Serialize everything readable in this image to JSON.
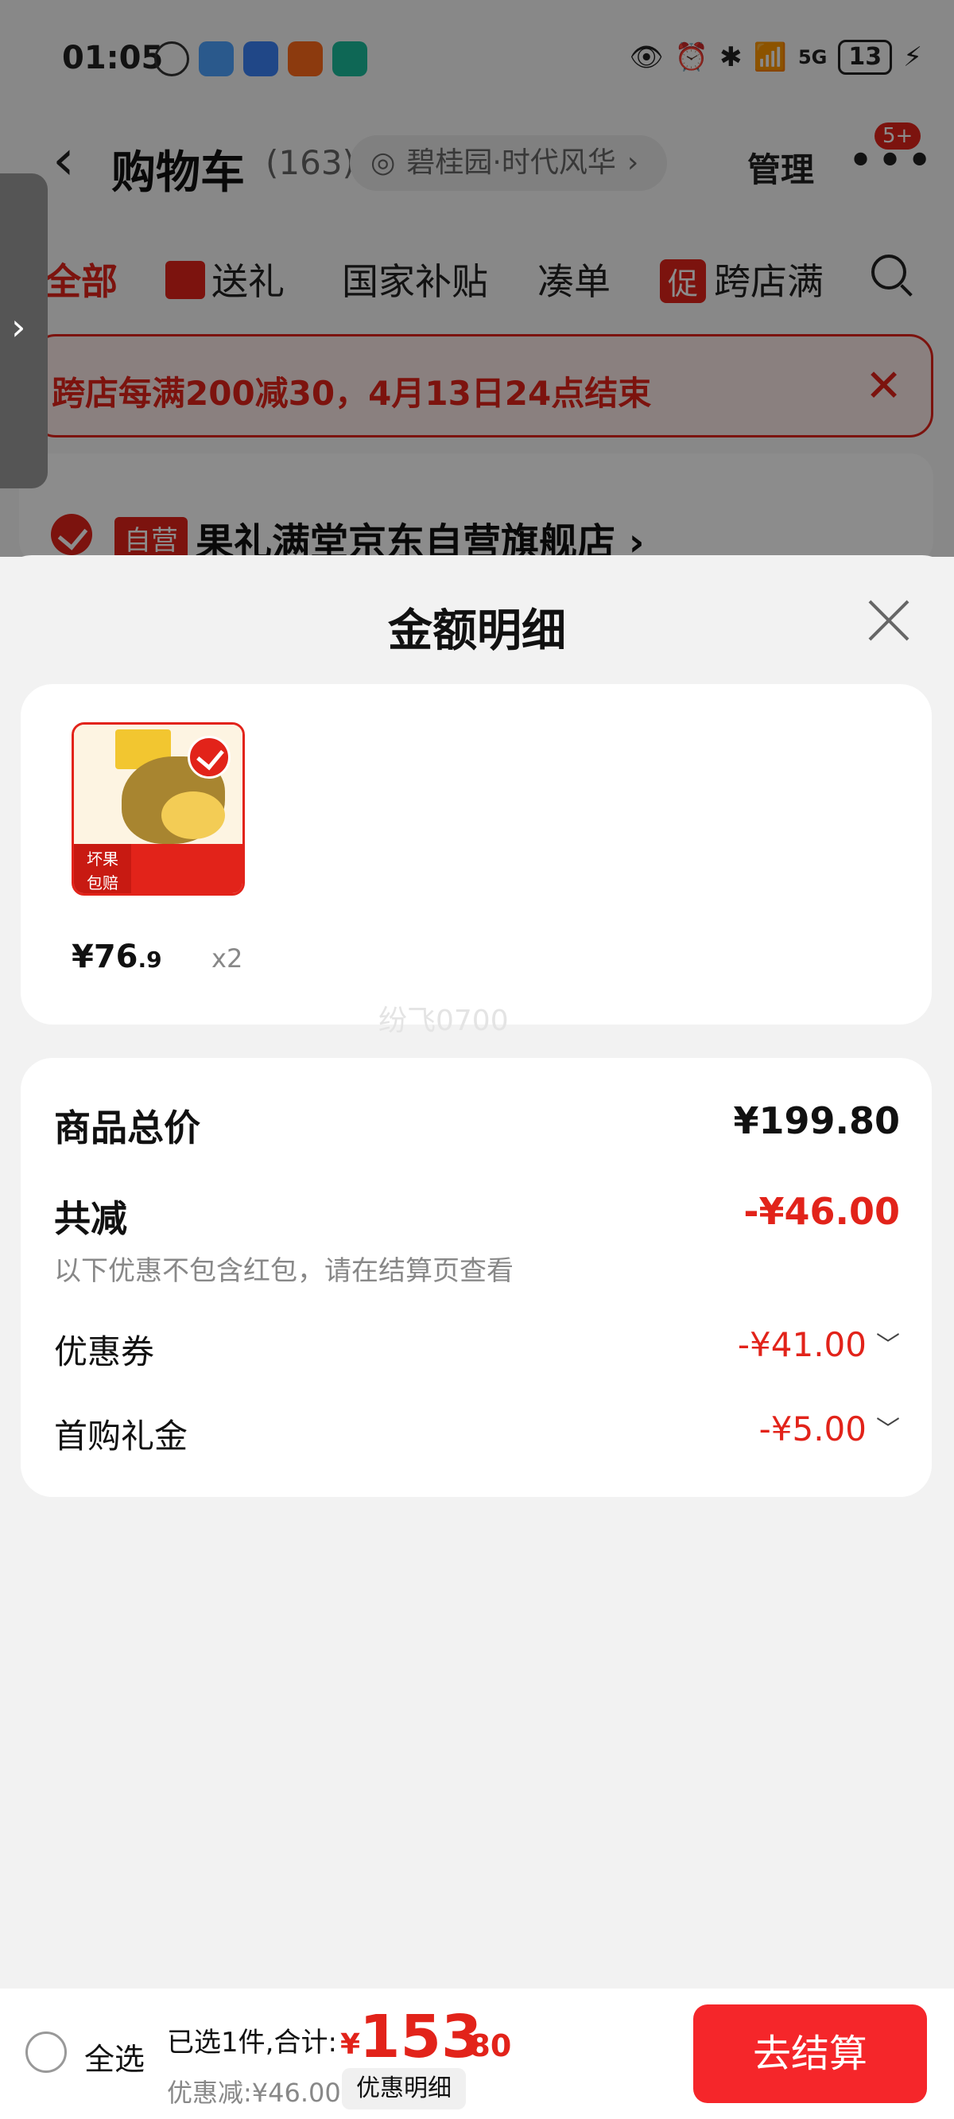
{
  "status_bar": {
    "time": "01:05",
    "network": "5G",
    "battery": "13"
  },
  "cart_header": {
    "title": "购物车",
    "count": "(163)",
    "location": "碧桂园·时代风华",
    "manage": "管理",
    "more_badge": "5+"
  },
  "tabs": [
    {
      "label": "全部"
    },
    {
      "label": "送礼"
    },
    {
      "label": "国家补贴"
    },
    {
      "label": "凑单"
    },
    {
      "label": "跨店满",
      "promo_tag": "促"
    }
  ],
  "promo_banner": {
    "text": "跨店每满200减30，4月13日24点结束"
  },
  "store": {
    "tag": "自营",
    "name": "果礼满堂京东自营旗舰店 ›"
  },
  "sheet": {
    "title": "金额明细",
    "product": {
      "price_int": "¥76",
      "price_dec": ".9",
      "qty": "x2",
      "image_tag_lines": [
        "坏果",
        "包赔"
      ]
    },
    "summary": {
      "total_label": "商品总价",
      "total_value": "¥199.80",
      "reduce_label": "共减",
      "reduce_value": "-¥46.00",
      "note": "以下优惠不包含红包，请在结算页查看",
      "coupon_label": "优惠券",
      "coupon_value": "-¥41.00",
      "gift_label": "首购礼金",
      "gift_value": "-¥5.00"
    }
  },
  "watermark": "纷飞0700",
  "bottom_bar": {
    "select_all": "全选",
    "selected_text": "已选1件,合计:",
    "total_currency": "¥",
    "total_int": "153",
    "total_dec": ".80",
    "discount_text": "优惠减:¥46.00",
    "detail_button": "优惠明细",
    "checkout_button": "去结算"
  },
  "colors": {
    "accent": "#e2231a",
    "checkout": "#f5262a"
  }
}
